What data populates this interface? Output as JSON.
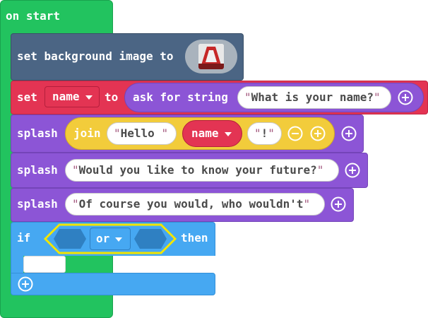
{
  "on_start": {
    "label": "on start"
  },
  "bg_block": {
    "label": "set background image to",
    "thumb_icon": "image-thumbnail-icon"
  },
  "set_block": {
    "set_label": "set",
    "variable": "name",
    "to_label": "to",
    "ask_label": "ask for string",
    "prompt": "What is your name?"
  },
  "splash1": {
    "label": "splash",
    "join_label": "join",
    "part1": "Hello ",
    "var": "name",
    "part3": "!"
  },
  "splash2": {
    "label": "splash",
    "text": "Would you like to know your future?"
  },
  "splash3": {
    "label": "splash",
    "text": "Of course you would, who wouldn't"
  },
  "if_block": {
    "if_label": "if",
    "op": "or",
    "then_label": "then"
  },
  "colors": {
    "event_green": "#22c35f",
    "scene_navy": "#4b6584",
    "variable_red": "#e33453",
    "sprite_purple": "#8c55d6",
    "join_yellow": "#f2cc3b",
    "logic_blue": "#46a8f2"
  }
}
